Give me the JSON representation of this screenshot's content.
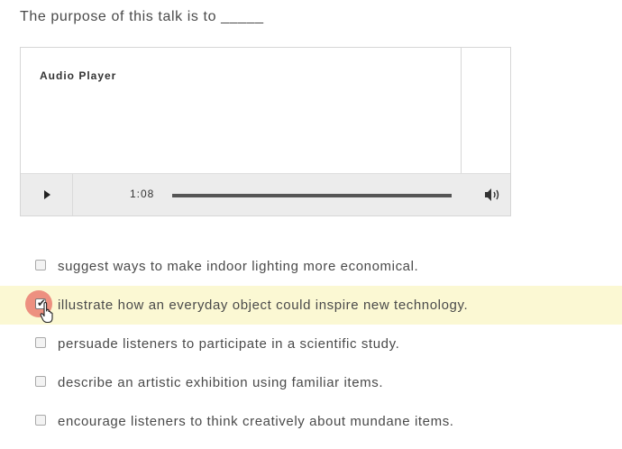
{
  "question": {
    "text": "The purpose of this talk is to _____"
  },
  "audio_player": {
    "title": "Audio Player",
    "time": "1:08",
    "progress_fraction": 1.0,
    "icons": {
      "play": "play-icon",
      "volume": "volume-icon"
    }
  },
  "options": [
    {
      "label": "suggest ways to make indoor lighting more economical.",
      "checked": false
    },
    {
      "label": "illustrate how an everyday object could inspire new technology.",
      "checked": true
    },
    {
      "label": "persuade listeners to participate in a scientific study.",
      "checked": false
    },
    {
      "label": "describe an artistic exhibition using familiar items.",
      "checked": false
    },
    {
      "label": "encourage listeners to think creatively about mundane items.",
      "checked": false
    }
  ],
  "colors": {
    "selected_row_highlight": "#fbf8d3",
    "click_ripple": "#e86e64",
    "controls_bar": "#ececec"
  }
}
